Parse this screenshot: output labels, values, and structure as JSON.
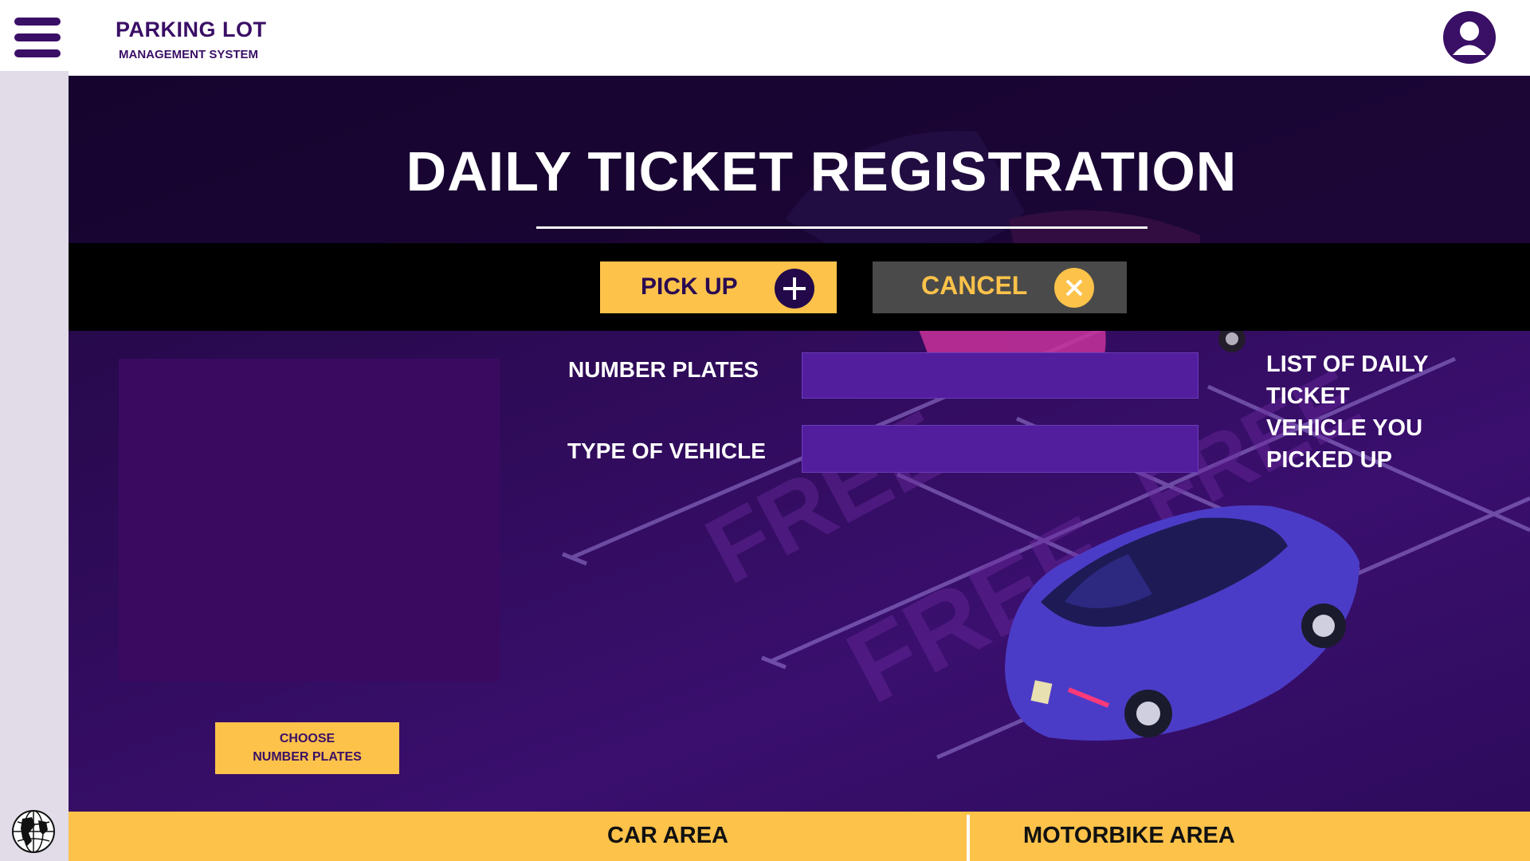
{
  "header": {
    "menu_icon": "hamburger-menu-icon",
    "brand_title": "PARKING LOT",
    "brand_subtitle": "MANAGEMENT SYSTEM",
    "avatar_icon": "user-profile-icon"
  },
  "sidebar": {
    "globe_icon": "globe-icon"
  },
  "main": {
    "page_title": "DAILY TICKET REGISTRATION",
    "actions": {
      "pickup_label": "PICK UP",
      "pickup_icon": "plus-icon",
      "cancel_label": "CANCEL",
      "cancel_icon": "close-icon"
    },
    "form": {
      "number_plates_label": "NUMBER PLATES",
      "number_plates_value": "",
      "type_of_vehicle_label": "TYPE OF VEHICLE",
      "type_of_vehicle_value": ""
    },
    "choose_plates": {
      "line1": "CHOOSE",
      "line2": "NUMBER PLATES"
    },
    "list_title": {
      "line1": "LIST OF DAILY",
      "line2": "TICKET",
      "line3": "VEHICLE YOU",
      "line4": "PICKED UP"
    },
    "background": {
      "watermark_text": "FREE"
    }
  },
  "bottom_tabs": {
    "car_area": "CAR AREA",
    "motorbike_area": "MOTORBIKE AREA"
  },
  "colors": {
    "brand_purple": "#3a0f66",
    "accent_yellow": "#fcc24a",
    "input_purple": "#521e9e",
    "cancel_gray": "#4a4a4a"
  }
}
